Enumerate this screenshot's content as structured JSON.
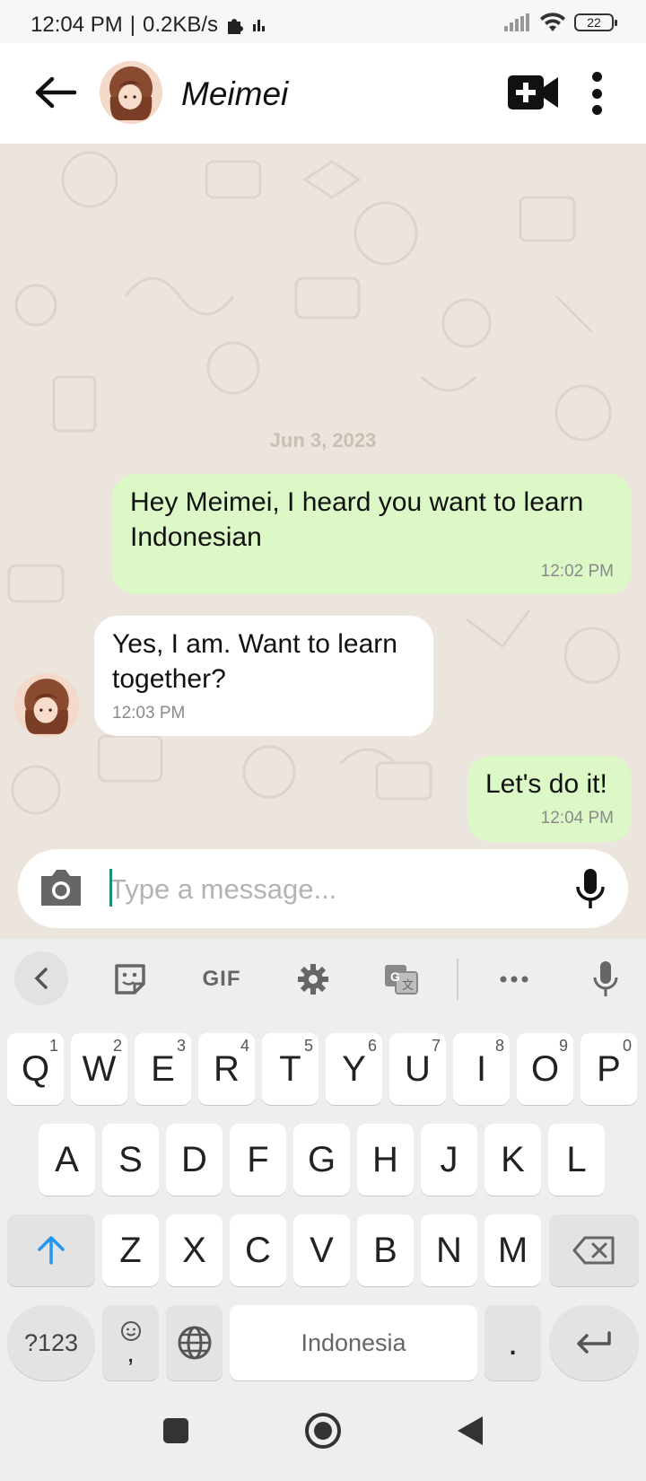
{
  "status_bar": {
    "time": "12:04 PM",
    "separator": "|",
    "network_speed": "0.2KB/s",
    "battery_level": "22",
    "icons": [
      "puzzle-icon",
      "data-bars-icon",
      "signal-icon",
      "wifi-icon",
      "battery-icon"
    ]
  },
  "header": {
    "contact_name": "Meimei",
    "icons": [
      "back-arrow-icon",
      "video-call-icon",
      "more-vert-icon"
    ]
  },
  "chat": {
    "date": "Jun 3, 2023",
    "messages": [
      {
        "direction": "outgoing",
        "text": "Hey Meimei, I heard you want to learn Indonesian",
        "time": "12:02 PM"
      },
      {
        "direction": "incoming",
        "text": "Yes, I am. Want to learn together?",
        "time": "12:03 PM"
      },
      {
        "direction": "outgoing",
        "text": "Let's do it!",
        "time": "12:04 PM"
      }
    ]
  },
  "composer": {
    "placeholder": "Type a message...",
    "value": "",
    "icons": [
      "camera-icon",
      "mic-icon"
    ]
  },
  "keyboard": {
    "toolbar": {
      "gif_label": "GIF",
      "icons": [
        "chevron-left-icon",
        "sticker-icon",
        "settings-icon",
        "translate-icon",
        "more-horiz-icon",
        "voice-input-icon"
      ]
    },
    "row1": [
      {
        "key": "Q",
        "hint": "1"
      },
      {
        "key": "W",
        "hint": "2"
      },
      {
        "key": "E",
        "hint": "3"
      },
      {
        "key": "R",
        "hint": "4"
      },
      {
        "key": "T",
        "hint": "5"
      },
      {
        "key": "Y",
        "hint": "6"
      },
      {
        "key": "U",
        "hint": "7"
      },
      {
        "key": "I",
        "hint": "8"
      },
      {
        "key": "O",
        "hint": "9"
      },
      {
        "key": "P",
        "hint": "0"
      }
    ],
    "row2": [
      "A",
      "S",
      "D",
      "F",
      "G",
      "H",
      "J",
      "K",
      "L"
    ],
    "row3": [
      "Z",
      "X",
      "C",
      "V",
      "B",
      "N",
      "M"
    ],
    "symbols_label": "?123",
    "emoji_comma_label": ",",
    "space_label": "Indonesia",
    "period_label": "."
  },
  "nav_bar": {
    "icons": [
      "recents-square-icon",
      "home-circle-icon",
      "back-triangle-icon"
    ]
  },
  "colors": {
    "outgoing_bubble": "#dcf8c6",
    "incoming_bubble": "#ffffff",
    "chat_background": "#ece5dd",
    "accent_caret": "#1f8a80",
    "shift_arrow": "#2196f3"
  }
}
